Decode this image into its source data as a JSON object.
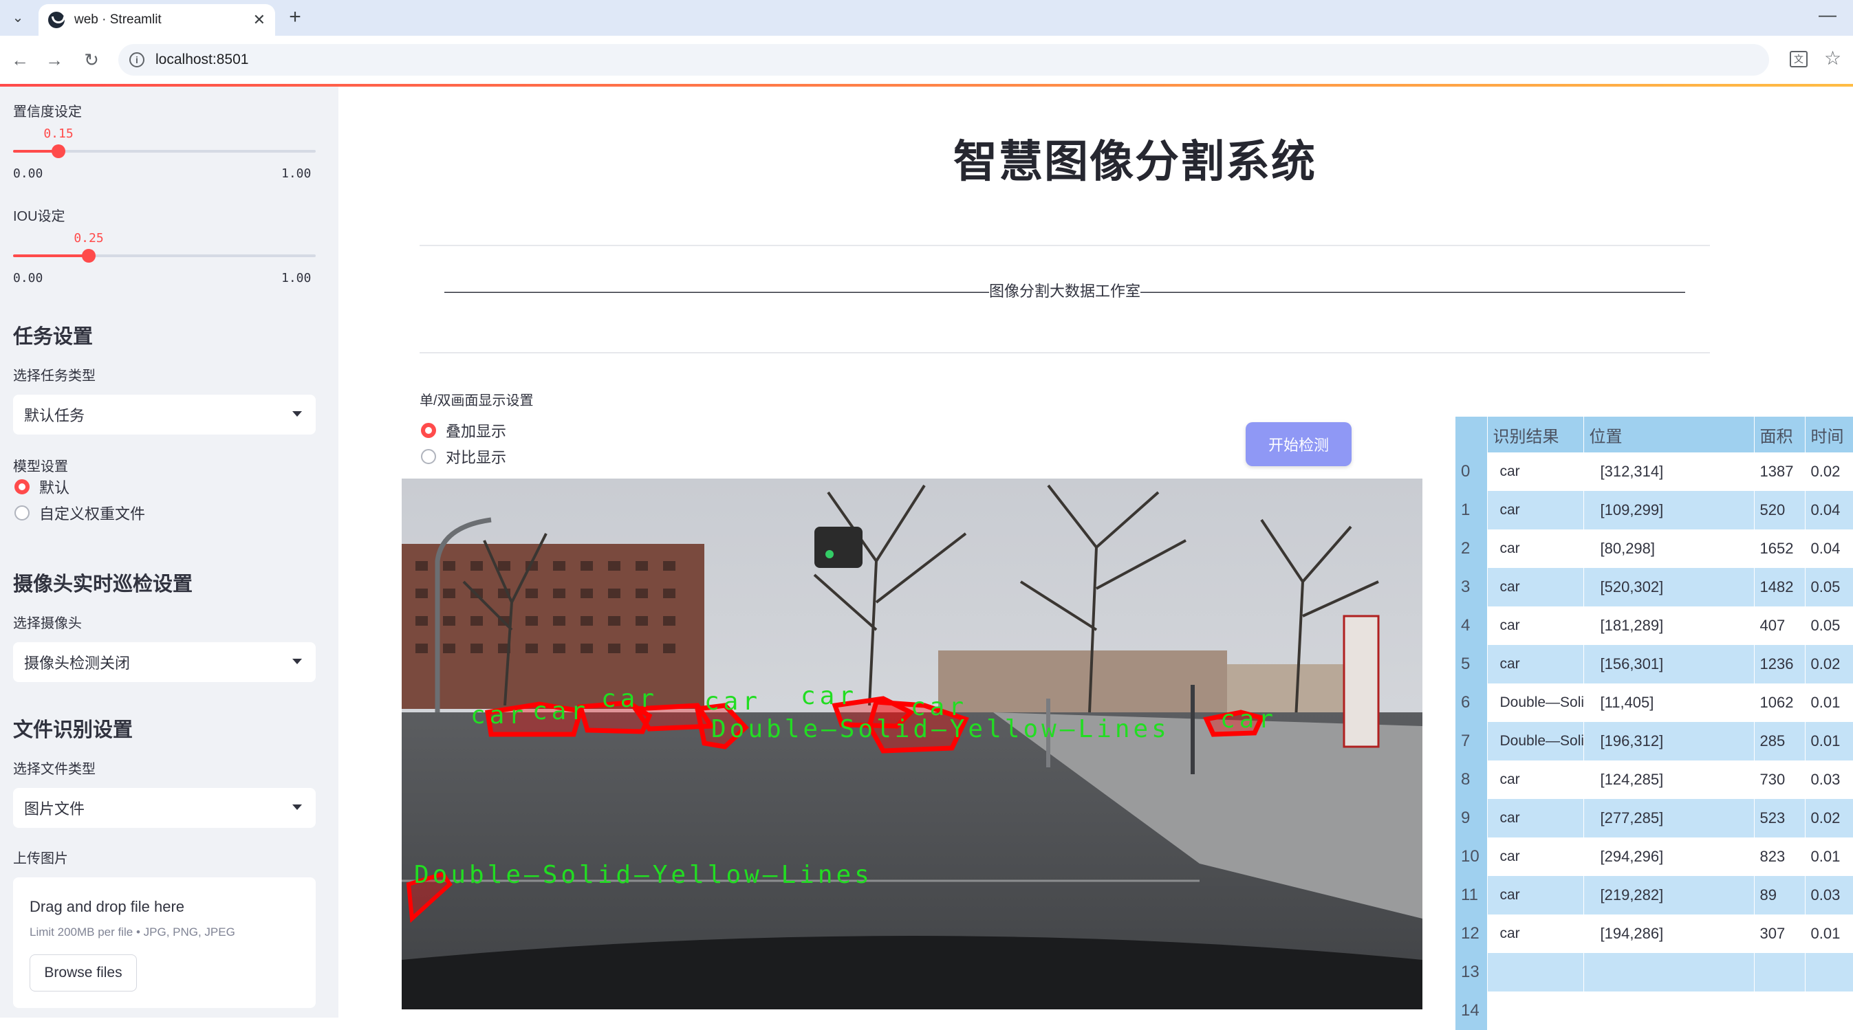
{
  "browser": {
    "tab_title": "web · Streamlit",
    "url": "localhost:8501"
  },
  "sidebar": {
    "confidence": {
      "label": "置信度设定",
      "value": "0.15",
      "min": "0.00",
      "max": "1.00",
      "fraction": 0.15
    },
    "iou": {
      "label": "IOU设定",
      "value": "0.25",
      "min": "0.00",
      "max": "1.00",
      "fraction": 0.25
    },
    "task": {
      "heading": "任务设置",
      "label": "选择任务类型",
      "selected": "默认任务"
    },
    "model": {
      "label": "模型设置",
      "options": [
        "默认",
        "自定义权重文件"
      ],
      "selected_index": 0
    },
    "camera": {
      "heading": "摄像头实时巡检设置",
      "label": "选择摄像头",
      "selected": "摄像头检测关闭"
    },
    "file": {
      "heading": "文件识别设置",
      "label": "选择文件类型",
      "selected": "图片文件"
    },
    "upload": {
      "label": "上传图片",
      "dropzone_title": "Drag and drop file here",
      "dropzone_limit": "Limit 200MB per file • JPG, PNG, JPEG",
      "browse_label": "Browse files"
    }
  },
  "main": {
    "title": "智慧图像分割系统",
    "divider_text": "————————————————————————————————————图像分割大数据工作室————————————————————————————————————",
    "display": {
      "label": "单/双画面显示设置",
      "options": [
        "叠加显示",
        "对比显示"
      ],
      "selected_index": 0
    },
    "start_button": "开始检测",
    "detections": {
      "labels": [
        "car",
        "car",
        "car",
        "car",
        "car",
        "car",
        "car",
        "Double—Solid—Yellow—Lines",
        "car",
        "car"
      ],
      "label_color": "#22dd22",
      "mask_color": "#ff0000"
    },
    "table": {
      "headers": [
        "",
        "识别结果",
        "位置",
        "面积",
        "时间"
      ],
      "rows": [
        {
          "idx": "0",
          "result": "car",
          "pos": "[312,314]",
          "area": "1387",
          "time": "0.02"
        },
        {
          "idx": "1",
          "result": "car",
          "pos": "[109,299]",
          "area": "520",
          "time": "0.04"
        },
        {
          "idx": "2",
          "result": "car",
          "pos": "[80,298]",
          "area": "1652",
          "time": "0.04"
        },
        {
          "idx": "3",
          "result": "car",
          "pos": "[520,302]",
          "area": "1482",
          "time": "0.05"
        },
        {
          "idx": "4",
          "result": "car",
          "pos": "[181,289]",
          "area": "407",
          "time": "0.05"
        },
        {
          "idx": "5",
          "result": "car",
          "pos": "[156,301]",
          "area": "1236",
          "time": "0.02"
        },
        {
          "idx": "6",
          "result": "Double—Solid—Yellow—Lines",
          "pos": "[11,405]",
          "area": "1062",
          "time": "0.01"
        },
        {
          "idx": "7",
          "result": "Double—Solid—Yellow—Lines",
          "pos": "[196,312]",
          "area": "285",
          "time": "0.01"
        },
        {
          "idx": "8",
          "result": "car",
          "pos": "[124,285]",
          "area": "730",
          "time": "0.03"
        },
        {
          "idx": "9",
          "result": "car",
          "pos": "[277,285]",
          "area": "523",
          "time": "0.02"
        },
        {
          "idx": "10",
          "result": "car",
          "pos": "[294,296]",
          "area": "823",
          "time": "0.01"
        },
        {
          "idx": "11",
          "result": "car",
          "pos": "[219,282]",
          "area": "89",
          "time": "0.03"
        },
        {
          "idx": "12",
          "result": "car",
          "pos": "[194,286]",
          "area": "307",
          "time": "0.01"
        },
        {
          "idx": "13",
          "result": "",
          "pos": "",
          "area": "",
          "time": ""
        },
        {
          "idx": "14",
          "result": "",
          "pos": "",
          "area": "",
          "time": ""
        }
      ]
    }
  }
}
